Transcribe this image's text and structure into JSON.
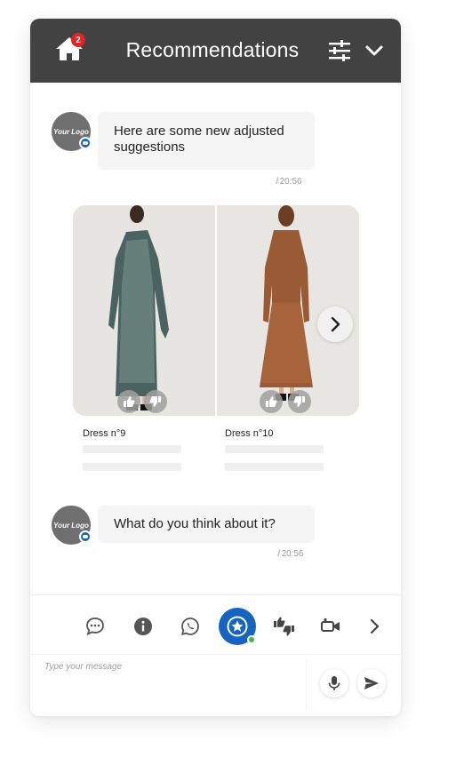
{
  "header": {
    "title": "Recommendations",
    "notification_count": "2"
  },
  "avatar": {
    "logo_text": "Your Logo"
  },
  "messages": [
    {
      "text": "Here are some new adjusted suggestions",
      "time": "20:56"
    },
    {
      "text": "What do you think about it?",
      "time": "20:56"
    }
  ],
  "products": [
    {
      "name": "Dress n°9"
    },
    {
      "name": "Dress n°10"
    }
  ],
  "toolbar": {
    "icons": [
      "chat-bubble-icon",
      "info-icon",
      "whatsapp-icon",
      "star-icon",
      "thumbs-up-down-icon",
      "video-call-icon",
      "chevron-right-icon"
    ],
    "active": "star-icon"
  },
  "composer": {
    "placeholder": "Type your message"
  },
  "colors": {
    "header_bg": "#424242",
    "accent": "#1565c0",
    "badge": "#e02424",
    "online": "#4caf50"
  }
}
